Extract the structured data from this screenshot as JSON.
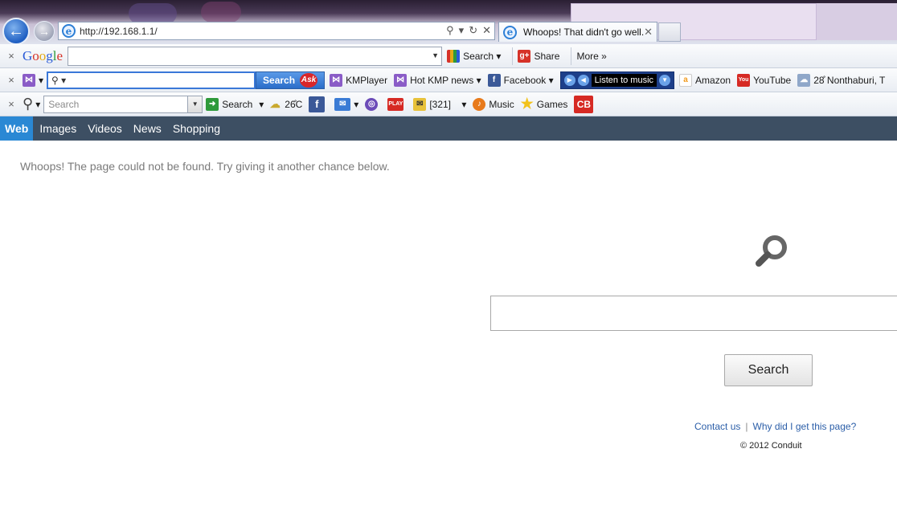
{
  "browser": {
    "address": "http://192.168.1.1/",
    "tab_title": "Whoops! That didn't go well.",
    "tab_close": "✕"
  },
  "toolbar_google": {
    "close": "×",
    "logo_letters": [
      "G",
      "o",
      "o",
      "g",
      "l",
      "e"
    ],
    "search_label": "Search",
    "share_label": "Share",
    "more_label": "More »"
  },
  "toolbar_ask": {
    "close": "×",
    "search_btn": "Search",
    "ask_badge": "Ask",
    "links": [
      "KMPlayer",
      "Hot KMP news",
      "Facebook"
    ],
    "music_label": "Listen to music",
    "amazon": "Amazon",
    "youtube": "YouTube",
    "weather": "28̊ Nonthaburi, T"
  },
  "toolbar_conduit": {
    "close": "×",
    "search_placeholder": "Search",
    "search_label": "Search",
    "temp": "26̊C",
    "count": "[321]",
    "music": "Music",
    "games": "Games",
    "cb": "CB"
  },
  "nav": {
    "tabs": [
      "Web",
      "Images",
      "Videos",
      "News",
      "Shopping"
    ],
    "active": "Web"
  },
  "page": {
    "message": "Whoops! The page could not be found. Try giving it another chance below.",
    "search_button": "Search",
    "contact": "Contact us",
    "separator": "|",
    "why": "Why did I get this page?",
    "copyright": "© 2012 Conduit"
  },
  "colors": {
    "nav_bg": "#3d4f63",
    "nav_active": "#2a88d4",
    "link": "#2b5ea8"
  }
}
